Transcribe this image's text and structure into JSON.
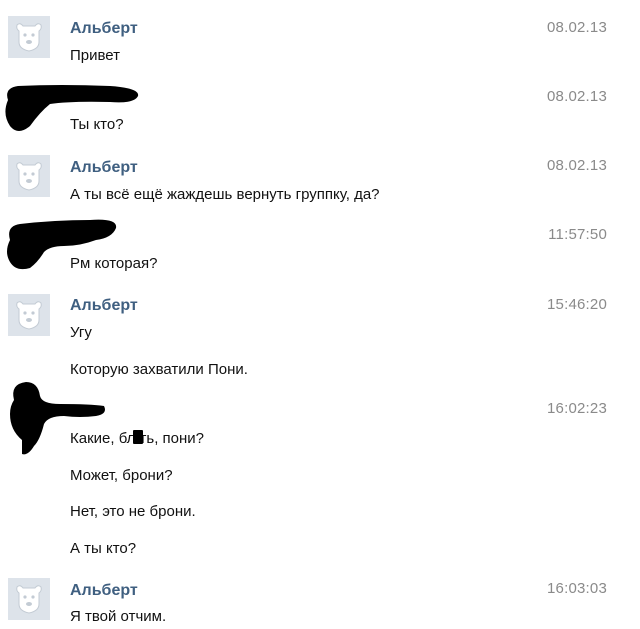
{
  "messages": [
    {
      "author": "Альберт",
      "time": "08.02.13",
      "lines": [
        "Привет"
      ]
    },
    {
      "author": "",
      "time": "08.02.13",
      "lines": [
        "Ты кто?"
      ]
    },
    {
      "author": "Альберт",
      "time": "08.02.13",
      "lines": [
        "А ты всё ещё жаждешь вернуть группку, да?"
      ]
    },
    {
      "author": "",
      "time": "11:57:50",
      "lines": [
        "Рм которая?"
      ]
    },
    {
      "author": "Альберт",
      "time": "15:46:20",
      "lines": [
        "Угу",
        "Которую захватили Пони."
      ]
    },
    {
      "author": "",
      "time": "16:02:23",
      "lines": [
        "Какие, бл  ть, пони?",
        "Может, брони?",
        "Нет, это не брони.",
        "А ты кто?"
      ]
    },
    {
      "author": "Альберт",
      "time": "16:03:03",
      "lines": [
        "Я твой отчим."
      ]
    }
  ],
  "colors": {
    "name": "#3f5f80",
    "time": "#8a8a8a",
    "avatar_bg": "#dde3ea"
  },
  "icons": {
    "default_avatar": "bear-avatar-icon",
    "redaction": "black-scribble-redaction"
  }
}
